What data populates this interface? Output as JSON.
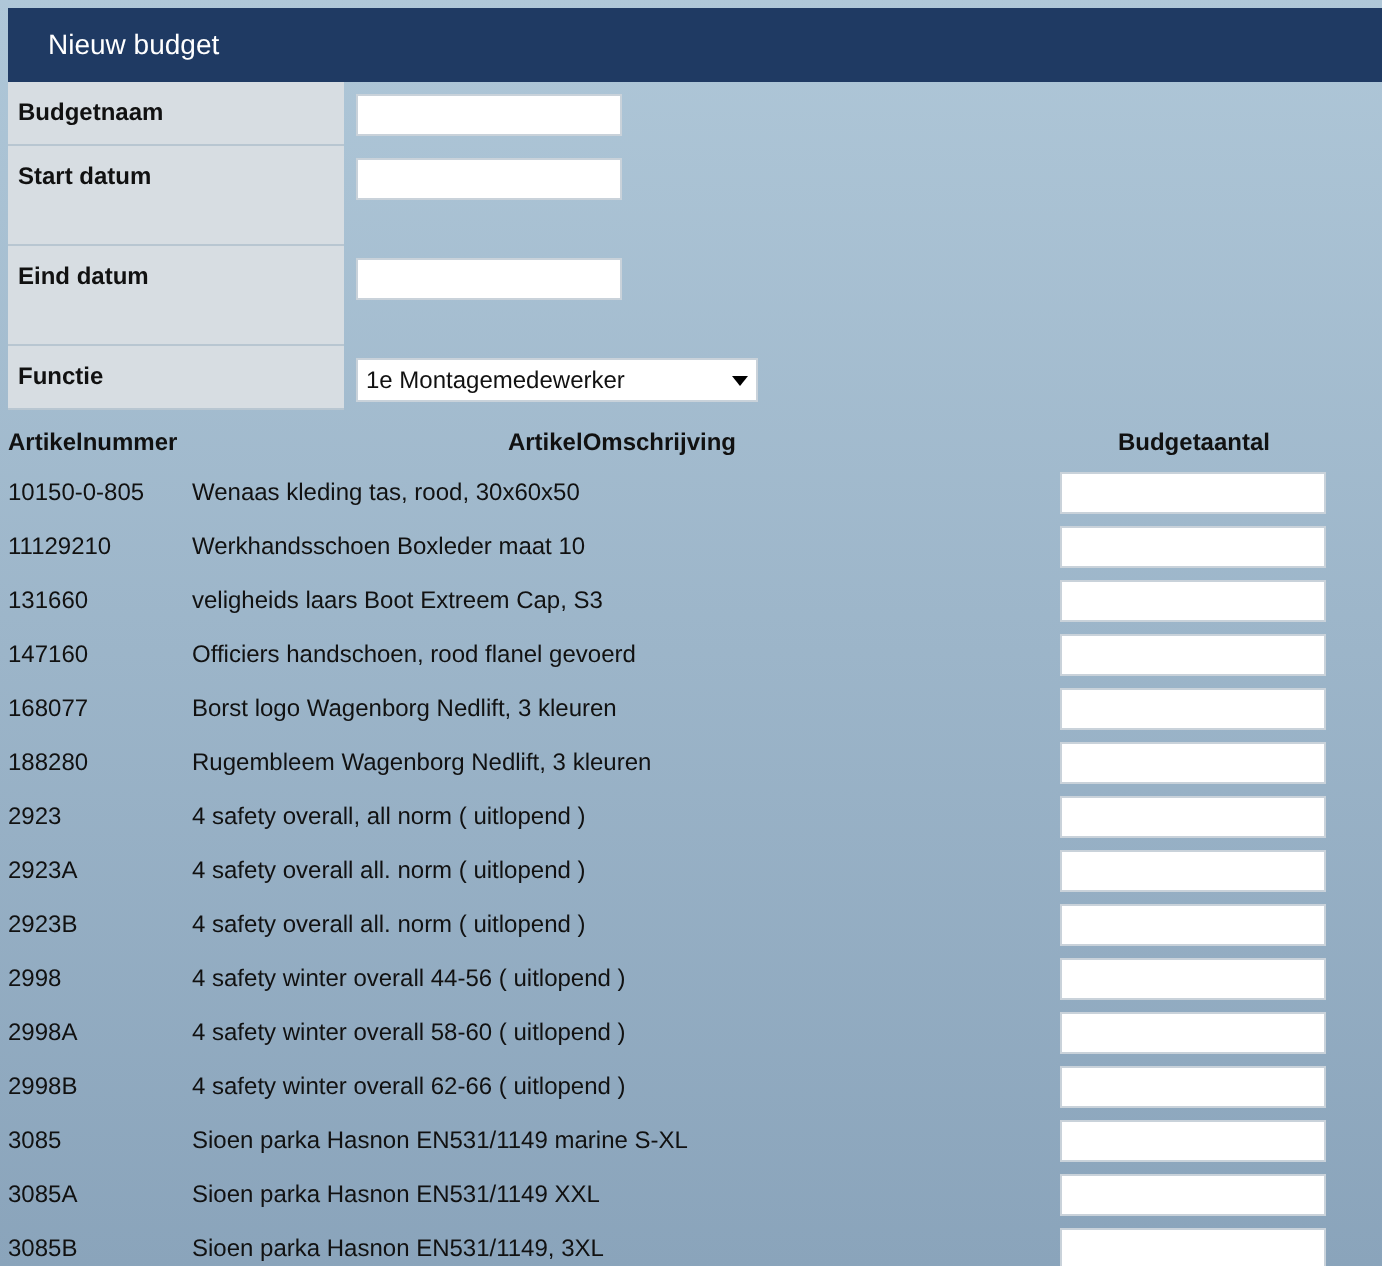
{
  "header": {
    "title": "Nieuw budget"
  },
  "form": [
    {
      "label": "Budgetnaam",
      "kind": "text"
    },
    {
      "label": "Start datum",
      "kind": "text"
    },
    {
      "label": "Eind datum",
      "kind": "text"
    },
    {
      "label": "Functie",
      "kind": "select",
      "value": "1e Montagemedewerker"
    }
  ],
  "table": {
    "columns": [
      "Artikelnummer",
      "ArtikelOmschrijving",
      "Budgetaantal"
    ],
    "rows": [
      {
        "number": "10150-0-805",
        "description": "Wenaas kleding tas, rood, 30x60x50"
      },
      {
        "number": "11129210",
        "description": "Werkhandsschoen Boxleder maat 10"
      },
      {
        "number": "131660",
        "description": "veligheids laars Boot Extreem Cap, S3"
      },
      {
        "number": "147160",
        "description": "Officiers handschoen, rood flanel gevoerd"
      },
      {
        "number": "168077",
        "description": "Borst logo Wagenborg Nedlift, 3 kleuren"
      },
      {
        "number": "188280",
        "description": "Rugembleem Wagenborg Nedlift, 3 kleuren"
      },
      {
        "number": "2923",
        "description": "4 safety overall, all norm ( uitlopend )"
      },
      {
        "number": "2923A",
        "description": "4 safety overall all. norm ( uitlopend )"
      },
      {
        "number": "2923B",
        "description": "4 safety overall all. norm ( uitlopend )"
      },
      {
        "number": "2998",
        "description": "4 safety winter overall 44-56 ( uitlopend )"
      },
      {
        "number": "2998A",
        "description": "4 safety winter overall 58-60 ( uitlopend )"
      },
      {
        "number": "2998B",
        "description": "4 safety winter overall 62-66 ( uitlopend )"
      },
      {
        "number": "3085",
        "description": "Sioen parka Hasnon EN531/1149 marine S-XL"
      },
      {
        "number": "3085A",
        "description": "Sioen parka Hasnon EN531/1149 XXL"
      },
      {
        "number": "3085B",
        "description": "Sioen parka Hasnon EN531/1149, 3XL"
      }
    ]
  }
}
